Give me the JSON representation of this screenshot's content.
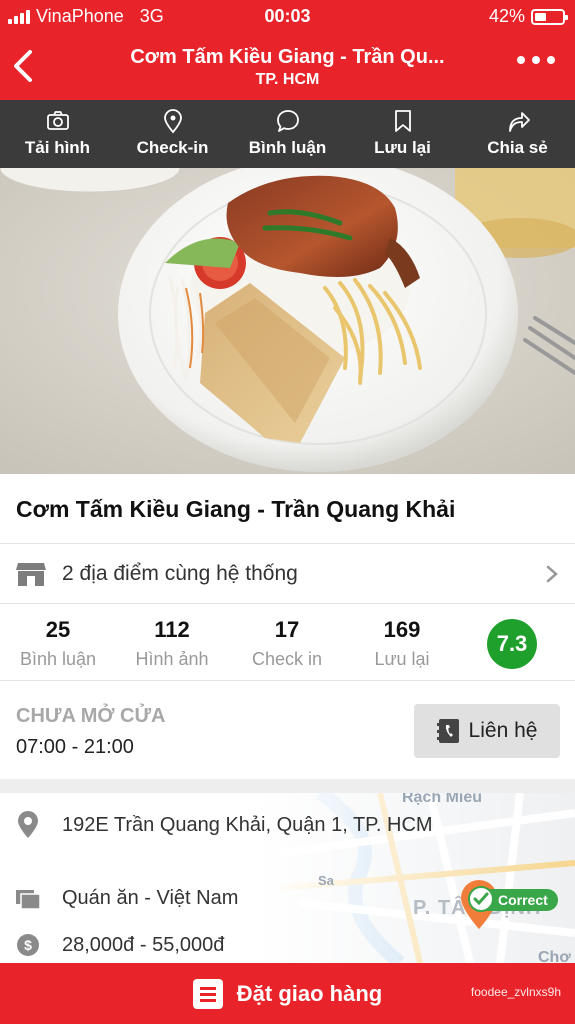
{
  "status_bar": {
    "carrier": "VinaPhone",
    "network": "3G",
    "time": "00:03",
    "battery": "42%"
  },
  "header": {
    "title": "Cơm Tấm Kiều Giang - Trần Qu...",
    "subtitle": "TP. HCM"
  },
  "actions": [
    {
      "label": "Tải hình",
      "icon": "camera-icon"
    },
    {
      "label": "Check-in",
      "icon": "map-pin-icon"
    },
    {
      "label": "Bình luận",
      "icon": "comment-icon"
    },
    {
      "label": "Lưu lại",
      "icon": "bookmark-icon"
    },
    {
      "label": "Chia sẻ",
      "icon": "share-icon"
    }
  ],
  "restaurant": {
    "name": "Cơm Tấm Kiều Giang - Trần Quang Khải",
    "chain_text": "2 địa điểm cùng hệ thống"
  },
  "stats": [
    {
      "value": "25",
      "label": "Bình luận"
    },
    {
      "value": "112",
      "label": "Hình ảnh"
    },
    {
      "value": "17",
      "label": "Check in"
    },
    {
      "value": "169",
      "label": "Lưu lại"
    }
  ],
  "score": "7.3",
  "hours": {
    "status": "CHƯA MỞ CỬA",
    "time": "07:00 - 21:00",
    "contact_label": "Liên hệ"
  },
  "info": {
    "address": "192E Trần Quang Khải, Quận 1, TP. HCM",
    "category": "Quán ăn - Việt Nam",
    "price": "28,000đ - 55,000đ"
  },
  "map": {
    "label_top": "Rạch Miễu",
    "label_district": "P. TÂN ĐỊNH",
    "label_street": "Sa",
    "label_bottom": "Chợ",
    "correct_label": "Correct"
  },
  "order": {
    "label": "Đặt giao hàng",
    "watermark": "foodee_zvlnxs9h"
  },
  "colors": {
    "brand_red": "#e8232a",
    "action_bar": "#3b3b3b",
    "score_green": "#1f9f2b"
  }
}
